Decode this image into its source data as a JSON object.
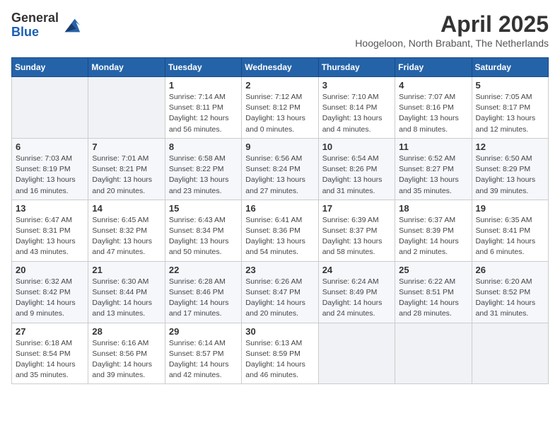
{
  "logo": {
    "general": "General",
    "blue": "Blue"
  },
  "title": "April 2025",
  "location": "Hoogeloon, North Brabant, The Netherlands",
  "days_of_week": [
    "Sunday",
    "Monday",
    "Tuesday",
    "Wednesday",
    "Thursday",
    "Friday",
    "Saturday"
  ],
  "weeks": [
    [
      {
        "day": "",
        "info": ""
      },
      {
        "day": "",
        "info": ""
      },
      {
        "day": "1",
        "info": "Sunrise: 7:14 AM\nSunset: 8:11 PM\nDaylight: 12 hours and 56 minutes."
      },
      {
        "day": "2",
        "info": "Sunrise: 7:12 AM\nSunset: 8:12 PM\nDaylight: 13 hours and 0 minutes."
      },
      {
        "day": "3",
        "info": "Sunrise: 7:10 AM\nSunset: 8:14 PM\nDaylight: 13 hours and 4 minutes."
      },
      {
        "day": "4",
        "info": "Sunrise: 7:07 AM\nSunset: 8:16 PM\nDaylight: 13 hours and 8 minutes."
      },
      {
        "day": "5",
        "info": "Sunrise: 7:05 AM\nSunset: 8:17 PM\nDaylight: 13 hours and 12 minutes."
      }
    ],
    [
      {
        "day": "6",
        "info": "Sunrise: 7:03 AM\nSunset: 8:19 PM\nDaylight: 13 hours and 16 minutes."
      },
      {
        "day": "7",
        "info": "Sunrise: 7:01 AM\nSunset: 8:21 PM\nDaylight: 13 hours and 20 minutes."
      },
      {
        "day": "8",
        "info": "Sunrise: 6:58 AM\nSunset: 8:22 PM\nDaylight: 13 hours and 23 minutes."
      },
      {
        "day": "9",
        "info": "Sunrise: 6:56 AM\nSunset: 8:24 PM\nDaylight: 13 hours and 27 minutes."
      },
      {
        "day": "10",
        "info": "Sunrise: 6:54 AM\nSunset: 8:26 PM\nDaylight: 13 hours and 31 minutes."
      },
      {
        "day": "11",
        "info": "Sunrise: 6:52 AM\nSunset: 8:27 PM\nDaylight: 13 hours and 35 minutes."
      },
      {
        "day": "12",
        "info": "Sunrise: 6:50 AM\nSunset: 8:29 PM\nDaylight: 13 hours and 39 minutes."
      }
    ],
    [
      {
        "day": "13",
        "info": "Sunrise: 6:47 AM\nSunset: 8:31 PM\nDaylight: 13 hours and 43 minutes."
      },
      {
        "day": "14",
        "info": "Sunrise: 6:45 AM\nSunset: 8:32 PM\nDaylight: 13 hours and 47 minutes."
      },
      {
        "day": "15",
        "info": "Sunrise: 6:43 AM\nSunset: 8:34 PM\nDaylight: 13 hours and 50 minutes."
      },
      {
        "day": "16",
        "info": "Sunrise: 6:41 AM\nSunset: 8:36 PM\nDaylight: 13 hours and 54 minutes."
      },
      {
        "day": "17",
        "info": "Sunrise: 6:39 AM\nSunset: 8:37 PM\nDaylight: 13 hours and 58 minutes."
      },
      {
        "day": "18",
        "info": "Sunrise: 6:37 AM\nSunset: 8:39 PM\nDaylight: 14 hours and 2 minutes."
      },
      {
        "day": "19",
        "info": "Sunrise: 6:35 AM\nSunset: 8:41 PM\nDaylight: 14 hours and 6 minutes."
      }
    ],
    [
      {
        "day": "20",
        "info": "Sunrise: 6:32 AM\nSunset: 8:42 PM\nDaylight: 14 hours and 9 minutes."
      },
      {
        "day": "21",
        "info": "Sunrise: 6:30 AM\nSunset: 8:44 PM\nDaylight: 14 hours and 13 minutes."
      },
      {
        "day": "22",
        "info": "Sunrise: 6:28 AM\nSunset: 8:46 PM\nDaylight: 14 hours and 17 minutes."
      },
      {
        "day": "23",
        "info": "Sunrise: 6:26 AM\nSunset: 8:47 PM\nDaylight: 14 hours and 20 minutes."
      },
      {
        "day": "24",
        "info": "Sunrise: 6:24 AM\nSunset: 8:49 PM\nDaylight: 14 hours and 24 minutes."
      },
      {
        "day": "25",
        "info": "Sunrise: 6:22 AM\nSunset: 8:51 PM\nDaylight: 14 hours and 28 minutes."
      },
      {
        "day": "26",
        "info": "Sunrise: 6:20 AM\nSunset: 8:52 PM\nDaylight: 14 hours and 31 minutes."
      }
    ],
    [
      {
        "day": "27",
        "info": "Sunrise: 6:18 AM\nSunset: 8:54 PM\nDaylight: 14 hours and 35 minutes."
      },
      {
        "day": "28",
        "info": "Sunrise: 6:16 AM\nSunset: 8:56 PM\nDaylight: 14 hours and 39 minutes."
      },
      {
        "day": "29",
        "info": "Sunrise: 6:14 AM\nSunset: 8:57 PM\nDaylight: 14 hours and 42 minutes."
      },
      {
        "day": "30",
        "info": "Sunrise: 6:13 AM\nSunset: 8:59 PM\nDaylight: 14 hours and 46 minutes."
      },
      {
        "day": "",
        "info": ""
      },
      {
        "day": "",
        "info": ""
      },
      {
        "day": "",
        "info": ""
      }
    ]
  ]
}
